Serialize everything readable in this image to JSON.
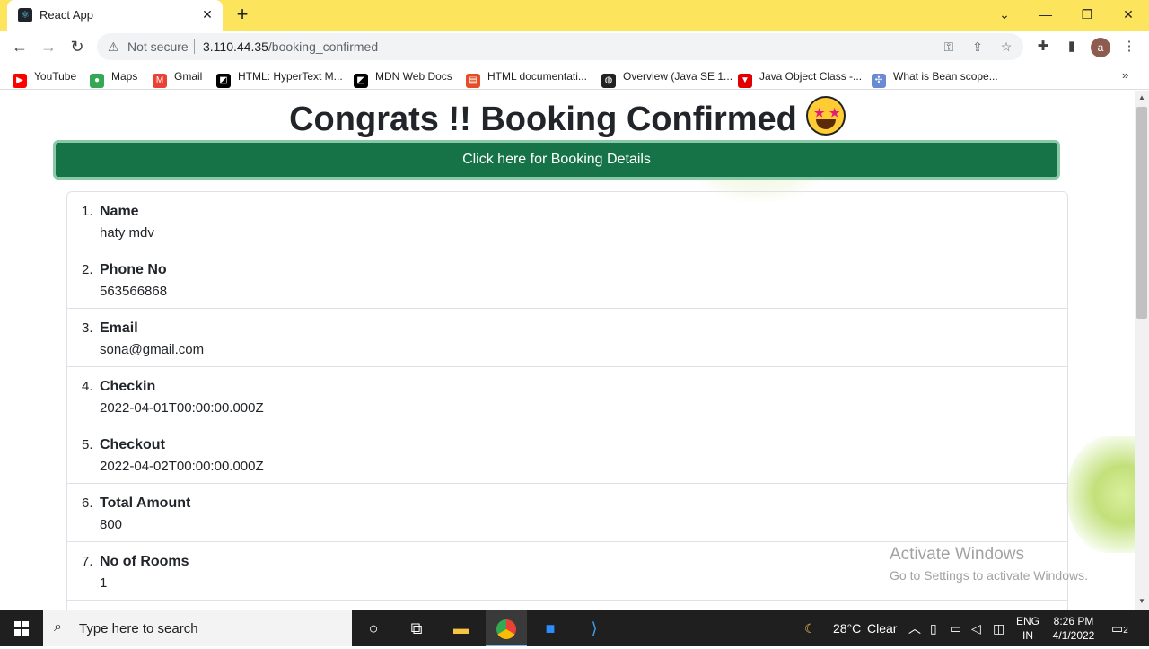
{
  "browser": {
    "tab_title": "React App",
    "tab_close": "✕",
    "new_tab": "+",
    "window_controls": {
      "chevron": "⌄",
      "minimize": "—",
      "restore": "❐",
      "close": "✕"
    },
    "security_label": "Not secure",
    "url_host": "3.110.44.35",
    "url_path": "/booking_confirmed",
    "profile_initial": "a",
    "bookmarks": [
      {
        "label": "YouTube",
        "icon": "youtube-icon",
        "color": "#ff0000"
      },
      {
        "label": "Maps",
        "icon": "maps-icon",
        "color": "#34a853"
      },
      {
        "label": "Gmail",
        "icon": "gmail-icon",
        "color": "#ea4335"
      },
      {
        "label": "HTML: HyperText M...",
        "icon": "mdn-icon",
        "color": "#000000"
      },
      {
        "label": "MDN Web Docs",
        "icon": "mdn-icon",
        "color": "#000000"
      },
      {
        "label": "HTML documentati...",
        "icon": "docs-icon",
        "color": "#e44d26"
      },
      {
        "label": "Overview (Java SE 1...",
        "icon": "globe-icon",
        "color": "#222222"
      },
      {
        "label": "Java Object Class -...",
        "icon": "javatpoint-icon",
        "color": "#e00000"
      },
      {
        "label": "What is Bean scope...",
        "icon": "bean-icon",
        "color": "#6a8bd4"
      }
    ]
  },
  "page": {
    "heading": "Congrats !! Booking Confirmed",
    "details_button": "Click here for Booking Details",
    "items": [
      {
        "num": "1.",
        "label": "Name",
        "value": "haty mdv"
      },
      {
        "num": "2.",
        "label": "Phone No",
        "value": "563566868"
      },
      {
        "num": "3.",
        "label": "Email",
        "value": "sona@gmail.com"
      },
      {
        "num": "4.",
        "label": "Checkin",
        "value": "2022-04-01T00:00:00.000Z"
      },
      {
        "num": "5.",
        "label": "Checkout",
        "value": "2022-04-02T00:00:00.000Z"
      },
      {
        "num": "6.",
        "label": "Total Amount",
        "value": "800"
      },
      {
        "num": "7.",
        "label": "No of Rooms",
        "value": "1"
      }
    ],
    "watermark_title": "Activate Windows",
    "watermark_sub": "Go to Settings to activate Windows."
  },
  "taskbar": {
    "search_placeholder": "Type here to search",
    "weather": "28°C",
    "weather_desc": "Clear",
    "lang_1": "ENG",
    "lang_2": "IN",
    "time": "8:26 PM",
    "date": "4/1/2022",
    "notifications": "2"
  }
}
